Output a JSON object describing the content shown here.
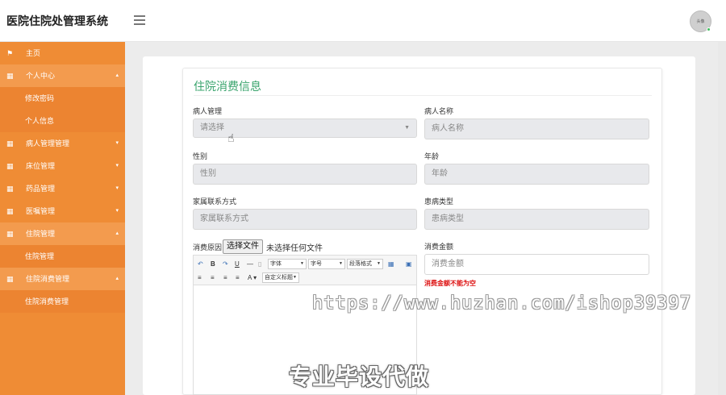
{
  "app": {
    "title": "医院住院处管理系统"
  },
  "header": {
    "avatar_text": "头像"
  },
  "sidebar": {
    "items": [
      {
        "label": "主页",
        "icon": "flag-icon",
        "glyph": "⚑",
        "type": "parent",
        "caret": ""
      },
      {
        "label": "个人中心",
        "icon": "grid-icon",
        "glyph": "▦",
        "type": "open",
        "caret": "▴"
      },
      {
        "label": "修改密码",
        "icon": "",
        "glyph": "",
        "type": "child",
        "caret": ""
      },
      {
        "label": "个人信息",
        "icon": "",
        "glyph": "",
        "type": "child",
        "caret": ""
      },
      {
        "label": "病人管理管理",
        "icon": "grid-icon",
        "glyph": "▦",
        "type": "parent",
        "caret": "▾"
      },
      {
        "label": "床位管理",
        "icon": "grid-icon",
        "glyph": "▦",
        "type": "parent",
        "caret": "▾"
      },
      {
        "label": "药品管理",
        "icon": "grid-icon",
        "glyph": "▦",
        "type": "parent",
        "caret": "▾"
      },
      {
        "label": "医嘱管理",
        "icon": "grid-icon",
        "glyph": "▦",
        "type": "parent",
        "caret": "▾"
      },
      {
        "label": "住院管理",
        "icon": "grid-icon",
        "glyph": "▦",
        "type": "open",
        "caret": "▴"
      },
      {
        "label": "住院管理",
        "icon": "",
        "glyph": "",
        "type": "child",
        "caret": ""
      },
      {
        "label": "住院消费管理",
        "icon": "grid-icon",
        "glyph": "▦",
        "type": "open",
        "caret": "▴"
      },
      {
        "label": "住院消费管理",
        "icon": "",
        "glyph": "",
        "type": "child",
        "caret": ""
      }
    ]
  },
  "form": {
    "title": "住院消费信息",
    "patient": {
      "label": "病人管理",
      "placeholder": "请选择"
    },
    "name": {
      "label": "病人名称",
      "placeholder": "病人名称"
    },
    "gender": {
      "label": "性别",
      "placeholder": "性别"
    },
    "age": {
      "label": "年龄",
      "placeholder": "年龄"
    },
    "contact": {
      "label": "家属联系方式",
      "placeholder": "家属联系方式"
    },
    "illness": {
      "label": "患病类型",
      "placeholder": "患病类型"
    },
    "reason": {
      "label": "消费原因",
      "file_button": "选择文件",
      "file_status": "未选择任何文件"
    },
    "amount": {
      "label": "消费金额",
      "placeholder": "消费金额",
      "error": "消费金额不能为空"
    }
  },
  "editor": {
    "font_family": "字体",
    "font_size": "字号",
    "paragraph": "段落格式",
    "custom_title": "自定义标题",
    "bold": "B",
    "underline": "U",
    "text_color": "A"
  },
  "watermark": {
    "url": "https://www.huzhan.com/ishop39397",
    "text": "专业毕设代做"
  },
  "colors": {
    "sidebar": "#ef8c35",
    "title": "#3aa46d",
    "error": "#dd1111"
  }
}
